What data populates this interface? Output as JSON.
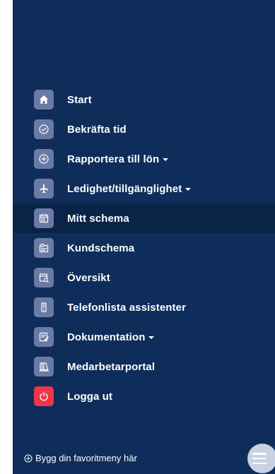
{
  "menu": {
    "items": [
      {
        "label": "Start",
        "icon": "home-icon",
        "has_submenu": false,
        "active": false
      },
      {
        "label": "Bekräfta tid",
        "icon": "check-circle-icon",
        "has_submenu": false,
        "active": false
      },
      {
        "label": "Rapportera till lön",
        "icon": "plus-circle-icon",
        "has_submenu": true,
        "active": false
      },
      {
        "label": "Ledighet/tillgänglighet",
        "icon": "airplane-icon",
        "has_submenu": true,
        "active": false
      },
      {
        "label": "Mitt schema",
        "icon": "calendar-icon",
        "has_submenu": false,
        "active": true
      },
      {
        "label": "Kundschema",
        "icon": "customer-schedule-icon",
        "has_submenu": false,
        "active": false
      },
      {
        "label": "Översikt",
        "icon": "overview-icon",
        "has_submenu": false,
        "active": false
      },
      {
        "label": "Telefonlista assistenter",
        "icon": "phone-icon",
        "has_submenu": false,
        "active": false
      },
      {
        "label": "Dokumentation",
        "icon": "document-edit-icon",
        "has_submenu": true,
        "active": false
      },
      {
        "label": "Medarbetarportal",
        "icon": "portal-icon",
        "has_submenu": false,
        "active": false
      },
      {
        "label": "Logga ut",
        "icon": "power-icon",
        "has_submenu": false,
        "active": false
      }
    ]
  },
  "footer": {
    "favorite_label": "Bygg din favoritmeny här"
  },
  "colors": {
    "panel_bg": "#0e2d5a",
    "active_bg": "#0a2447",
    "icon_bg": "#6b7aa5",
    "logout_bg": "#f0354a"
  }
}
